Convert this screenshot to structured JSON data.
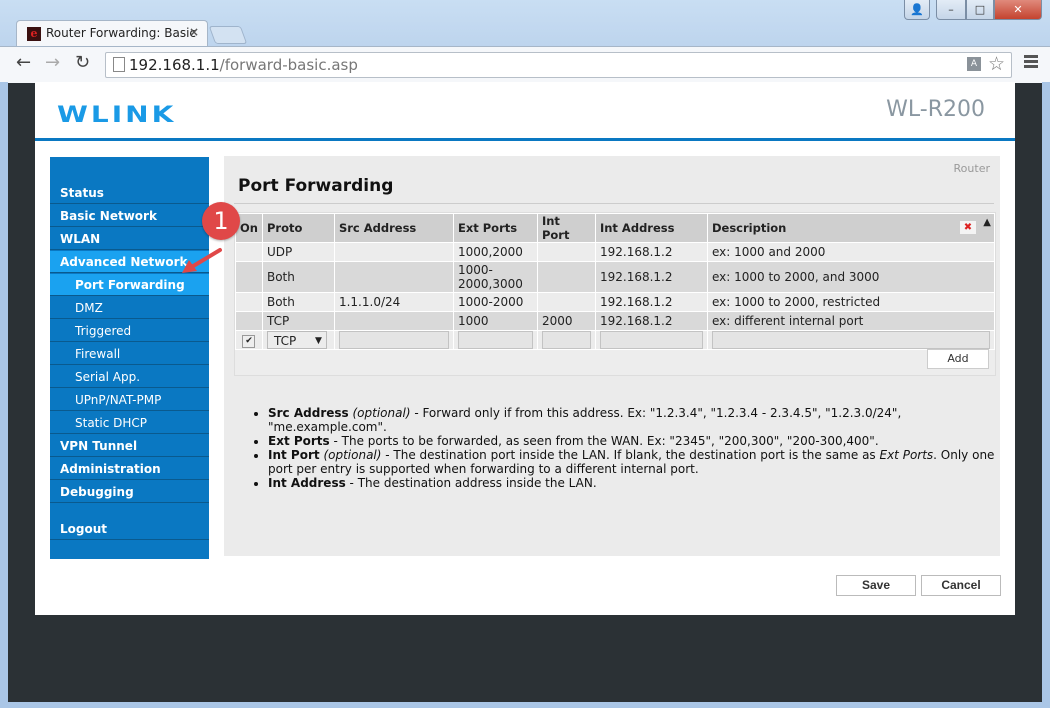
{
  "browser": {
    "tab_title": "Router Forwarding: Basic",
    "tab_close": "×",
    "url_host": "192.168.1.1",
    "url_path": "/forward-basic.asp",
    "window_controls": {
      "close": "✕",
      "minimize": "–",
      "maximize": "□",
      "user": "user-icon"
    }
  },
  "header": {
    "logo": "WLINK",
    "model": "WL-R200"
  },
  "sidebar": {
    "items": [
      {
        "label": "Status",
        "level": 0
      },
      {
        "label": "Basic Network",
        "level": 0
      },
      {
        "label": "WLAN",
        "level": 0
      },
      {
        "label": "Advanced Network",
        "level": 0,
        "active": true
      },
      {
        "label": "Port Forwarding",
        "level": 1,
        "active": true
      },
      {
        "label": "DMZ",
        "level": 1
      },
      {
        "label": "Triggered",
        "level": 1
      },
      {
        "label": "Firewall",
        "level": 1
      },
      {
        "label": "Serial App.",
        "level": 1
      },
      {
        "label": "UPnP/NAT-PMP",
        "level": 1
      },
      {
        "label": "Static DHCP",
        "level": 1
      },
      {
        "label": "VPN Tunnel",
        "level": 0
      },
      {
        "label": "Administration",
        "level": 0
      },
      {
        "label": "Debugging",
        "level": 0
      },
      {
        "label": "Logout",
        "level": 0
      }
    ]
  },
  "content": {
    "breadcrumb": "Router",
    "title": "Port Forwarding",
    "table": {
      "headers": [
        "On",
        "Proto",
        "Src Address",
        "Ext Ports",
        "Int Port",
        "Int Address",
        "Description"
      ],
      "rows": [
        {
          "on": "",
          "proto": "UDP",
          "src": "",
          "ext": "1000,2000",
          "int_port": "",
          "int_addr": "192.168.1.2",
          "desc": "ex: 1000 and 2000"
        },
        {
          "on": "",
          "proto": "Both",
          "src": "",
          "ext": "1000-2000,3000",
          "int_port": "",
          "int_addr": "192.168.1.2",
          "desc": "ex: 1000 to 2000, and 3000"
        },
        {
          "on": "",
          "proto": "Both",
          "src": "1.1.1.0/24",
          "ext": "1000-2000",
          "int_port": "",
          "int_addr": "192.168.1.2",
          "desc": "ex: 1000 to 2000, restricted"
        },
        {
          "on": "",
          "proto": "TCP",
          "src": "",
          "ext": "1000",
          "int_port": "2000",
          "int_addr": "192.168.1.2",
          "desc": "ex: different internal port"
        }
      ],
      "new_row": {
        "enabled_mark": "✔",
        "proto_selected": "TCP",
        "src": "",
        "ext": "",
        "int_port": "",
        "int_addr": "",
        "desc": ""
      },
      "delete_icon": "✖",
      "sort_icon": "▲",
      "add_label": "Add"
    },
    "notes": [
      {
        "term": "Src Address",
        "optional": "(optional)",
        "text": " - Forward only if from this address. Ex: \"1.2.3.4\", \"1.2.3.4 - 2.3.4.5\", \"1.2.3.0/24\", \"me.example.com\"."
      },
      {
        "term": "Ext Ports",
        "optional": "",
        "text": " - The ports to be forwarded, as seen from the WAN. Ex: \"2345\", \"200,300\", \"200-300,400\"."
      },
      {
        "term": "Int Port",
        "optional": "(optional)",
        "text": " - The destination port inside the LAN. If blank, the destination port is the same as ",
        "em": "Ext Ports",
        "text2": ". Only one port per entry is supported when forwarding to a different internal port."
      },
      {
        "term": "Int Address",
        "optional": "",
        "text": " - The destination address inside the LAN."
      }
    ]
  },
  "footer": {
    "save_label": "Save",
    "cancel_label": "Cancel"
  },
  "annotation": {
    "badge_number": "1"
  }
}
